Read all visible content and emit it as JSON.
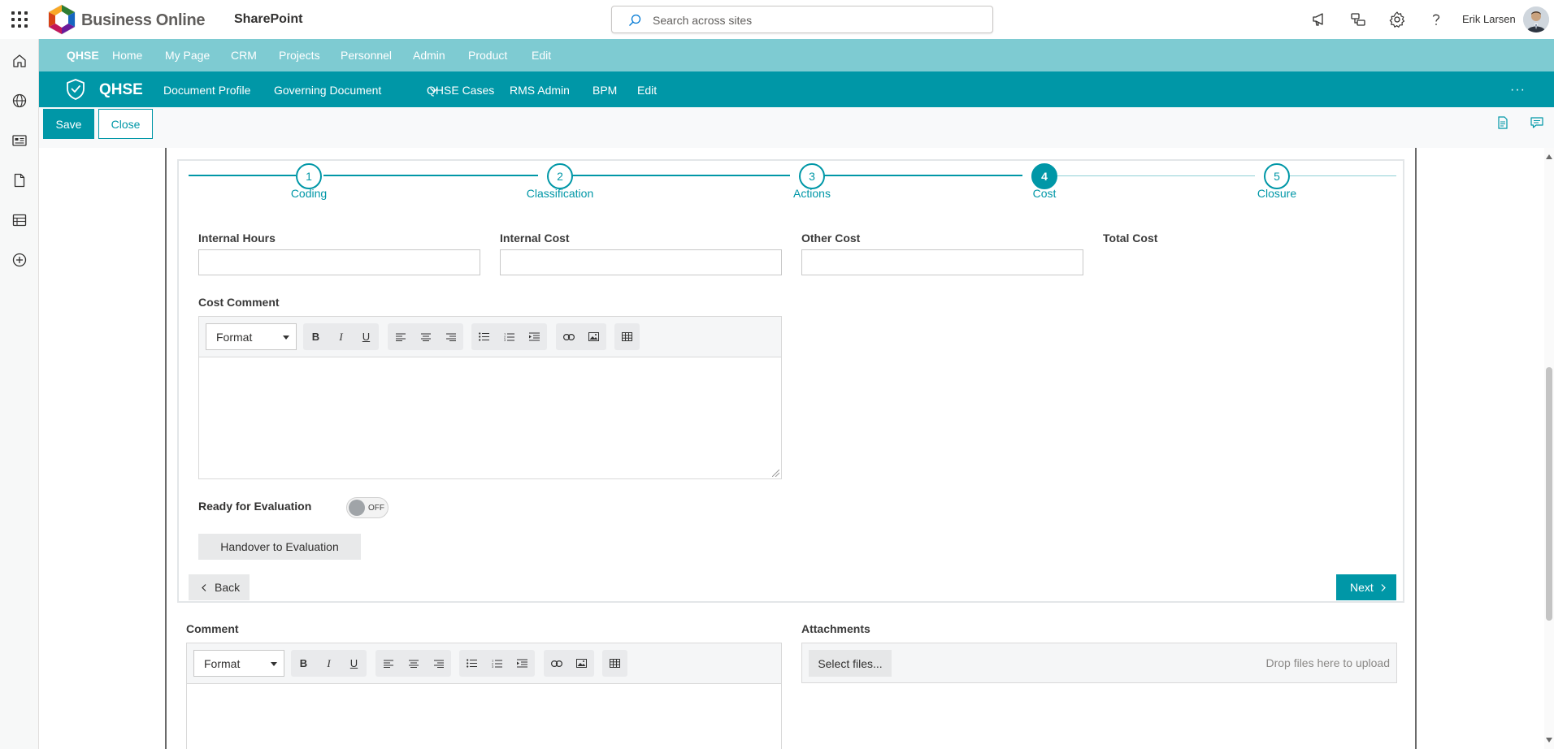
{
  "suite": {
    "brand": "Business Online",
    "app_name": "SharePoint",
    "search_placeholder": "Search across sites",
    "user_name": "Erik Larsen"
  },
  "hub_nav": {
    "items": [
      "QHSE",
      "Home",
      "My Page",
      "CRM",
      "Projects",
      "Personnel",
      "Admin",
      "Product",
      "Edit"
    ]
  },
  "site_header": {
    "title": "QHSE",
    "nav": [
      "Document Profile",
      "Governing Document",
      "QHSE Cases",
      "RMS Admin",
      "BPM",
      "Edit"
    ],
    "more": "···"
  },
  "command_bar": {
    "save_label": "Save",
    "close_label": "Close"
  },
  "stepper": {
    "steps": [
      {
        "number": "1",
        "label": "Coding"
      },
      {
        "number": "2",
        "label": "Classification"
      },
      {
        "number": "3",
        "label": "Actions"
      },
      {
        "number": "4",
        "label": "Cost"
      },
      {
        "number": "5",
        "label": "Closure"
      }
    ],
    "active_step": 4
  },
  "cost_form": {
    "internal_hours_label": "Internal Hours",
    "internal_hours_value": "",
    "internal_cost_label": "Internal Cost",
    "internal_cost_value": "",
    "other_cost_label": "Other Cost",
    "other_cost_value": "",
    "total_cost_label": "Total Cost",
    "cost_comment_label": "Cost Comment",
    "format_label": "Format",
    "ready_label": "Ready for Evaluation",
    "toggle_state": "OFF",
    "handover_label": "Handover to Evaluation",
    "back_label": "Back",
    "next_label": "Next"
  },
  "comment_section": {
    "comment_label": "Comment",
    "format_label": "Format",
    "attachments_label": "Attachments",
    "select_files_label": "Select files...",
    "drop_text": "Drop files here to upload"
  },
  "colors": {
    "hub_nav_bg": "#7ecbd2",
    "site_header_bg": "#0097a7",
    "accent": "#0097a7"
  },
  "icons": {
    "appbar": [
      "home-icon",
      "globe-icon",
      "news-icon",
      "document-icon",
      "list-icon",
      "add-circle-icon"
    ],
    "top_right": [
      "megaphone-icon",
      "share-icon",
      "gear-icon",
      "help-icon"
    ]
  }
}
